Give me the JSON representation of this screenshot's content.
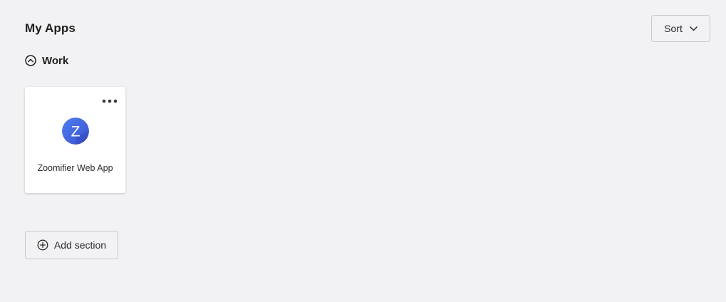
{
  "header": {
    "title": "My Apps",
    "sort_label": "Sort"
  },
  "section": {
    "title": "Work",
    "toggle_icon": "chevron-up-circle-icon",
    "apps": [
      {
        "name": "Zoomifier Web App",
        "logo_letter": "Z",
        "logo_color": "#3b5bdb",
        "logo_color_light": "#4c7ff0"
      }
    ]
  },
  "footer": {
    "add_section_label": "Add section",
    "add_icon": "plus-circle-icon"
  }
}
